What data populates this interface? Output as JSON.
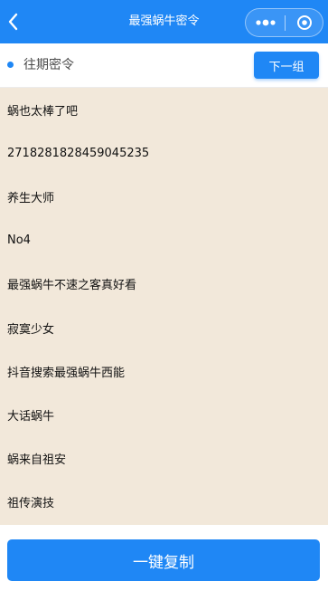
{
  "navbar": {
    "title": "最强蜗牛密令",
    "back_icon": "chevron-left-icon",
    "capsule": {
      "more_icon": "more-dots-icon",
      "close_icon": "target-circle-icon"
    },
    "color": "#1f87f5"
  },
  "section": {
    "title": "往期密令",
    "next_label": "下一组"
  },
  "codes": [
    "蜗也太棒了吧",
    "2718281828459045235",
    "养生大师",
    "No4",
    "最强蜗牛不速之客真好看",
    "寂寞少女",
    "抖音搜索最强蜗牛西能",
    "大话蜗牛",
    "蜗来自祖安",
    "祖传演技"
  ],
  "footer": {
    "copy_label": "一键复制"
  },
  "colors": {
    "accent": "#1f87f5",
    "list_bg": "#f2e8da"
  }
}
